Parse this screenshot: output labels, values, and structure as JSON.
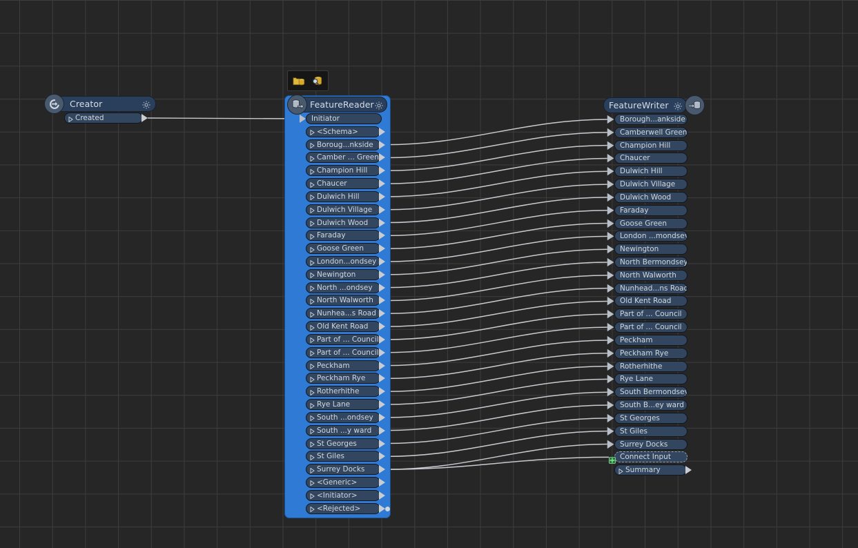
{
  "canvas": {
    "background_color": "#262626",
    "grid_color": "#3d3d3d",
    "wire_color": "#c8cbd0"
  },
  "toolbar": {
    "name": "reader-toolbar",
    "buttons": [
      {
        "name": "open-dataset-icon",
        "label": "Open Dataset",
        "color": "#e8c84a"
      },
      {
        "name": "inspect-dataset-icon",
        "label": "Inspect Dataset",
        "color": "#d8b35c"
      }
    ]
  },
  "nodes": {
    "creator": {
      "title": "Creator",
      "icon": "creator-icon",
      "gear": "gear-icon",
      "accent": "#2a3f5c",
      "ports": [
        {
          "name": "Created",
          "kind": "output"
        }
      ]
    },
    "feature_reader": {
      "title": "FeatureReader",
      "icon": "database-read-icon",
      "gear": "gear-icon",
      "accent": "#2e7ad4",
      "input_ports": [
        {
          "name": "Initiator",
          "kind": "input"
        }
      ],
      "output_ports": [
        {
          "name": "<Schema>",
          "connected": false
        },
        {
          "name": "Boroug...nkside",
          "connected": true
        },
        {
          "name": "Camber ... Green",
          "connected": true
        },
        {
          "name": "Champion Hill",
          "connected": true
        },
        {
          "name": "Chaucer",
          "connected": true
        },
        {
          "name": "Dulwich Hill",
          "connected": true
        },
        {
          "name": "Dulwich Village",
          "connected": true
        },
        {
          "name": "Dulwich Wood",
          "connected": true
        },
        {
          "name": "Faraday",
          "connected": true
        },
        {
          "name": "Goose Green",
          "connected": true
        },
        {
          "name": "London...ondsey",
          "connected": true
        },
        {
          "name": "Newington",
          "connected": true
        },
        {
          "name": "North ...ondsey",
          "connected": true
        },
        {
          "name": "North Walworth",
          "connected": true
        },
        {
          "name": "Nunhea...s Road",
          "connected": true
        },
        {
          "name": "Old Kent Road",
          "connected": true
        },
        {
          "name": "Part of ... Council",
          "connected": true
        },
        {
          "name": "Part of ... Council",
          "connected": true
        },
        {
          "name": "Peckham",
          "connected": true
        },
        {
          "name": "Peckham Rye",
          "connected": true
        },
        {
          "name": "Rotherhithe",
          "connected": true
        },
        {
          "name": "Rye Lane",
          "connected": true
        },
        {
          "name": "South ...ondsey",
          "connected": true
        },
        {
          "name": "South ...y ward",
          "connected": true
        },
        {
          "name": "St Georges",
          "connected": true
        },
        {
          "name": "St Giles",
          "connected": true
        },
        {
          "name": "Surrey Docks",
          "connected": true
        },
        {
          "name": "<Generic>",
          "connected": false
        },
        {
          "name": "<Initiator>",
          "connected": false
        },
        {
          "name": "<Rejected>",
          "connected": false
        }
      ]
    },
    "feature_writer": {
      "title": "FeatureWriter",
      "icon": "database-write-icon",
      "gear": "gear-icon",
      "accent": "#2a3f5c",
      "input_ports": [
        {
          "name": "Borough...ankside",
          "connected": true
        },
        {
          "name": "Camberwell Green",
          "connected": true
        },
        {
          "name": "Champion Hill",
          "connected": true
        },
        {
          "name": "Chaucer",
          "connected": true
        },
        {
          "name": "Dulwich Hill",
          "connected": true
        },
        {
          "name": "Dulwich Village",
          "connected": true
        },
        {
          "name": "Dulwich Wood",
          "connected": true
        },
        {
          "name": "Faraday",
          "connected": true
        },
        {
          "name": "Goose Green",
          "connected": true
        },
        {
          "name": "London ...mondsey",
          "connected": true
        },
        {
          "name": "Newington",
          "connected": true
        },
        {
          "name": "North Bermondsey",
          "connected": true
        },
        {
          "name": "North Walworth",
          "connected": true
        },
        {
          "name": "Nunhead...ns Road",
          "connected": true
        },
        {
          "name": "Old Kent Road",
          "connected": true
        },
        {
          "name": "Part of ... Council",
          "connected": true
        },
        {
          "name": "Part of ... Council",
          "connected": true
        },
        {
          "name": "Peckham",
          "connected": true
        },
        {
          "name": "Peckham Rye",
          "connected": true
        },
        {
          "name": "Rotherhithe",
          "connected": true
        },
        {
          "name": "Rye Lane",
          "connected": true
        },
        {
          "name": "South Bermondsey",
          "connected": true
        },
        {
          "name": "South B...ey ward",
          "connected": true
        },
        {
          "name": "St Georges",
          "connected": true
        },
        {
          "name": "St Giles",
          "connected": true
        },
        {
          "name": "Surrey Docks",
          "connected": true
        }
      ],
      "connect_input": {
        "name": "Connect Input",
        "icon": "green-plus-icon",
        "icon_color": "#3fbf5a"
      },
      "output_ports": [
        {
          "name": "Summary"
        }
      ]
    }
  }
}
